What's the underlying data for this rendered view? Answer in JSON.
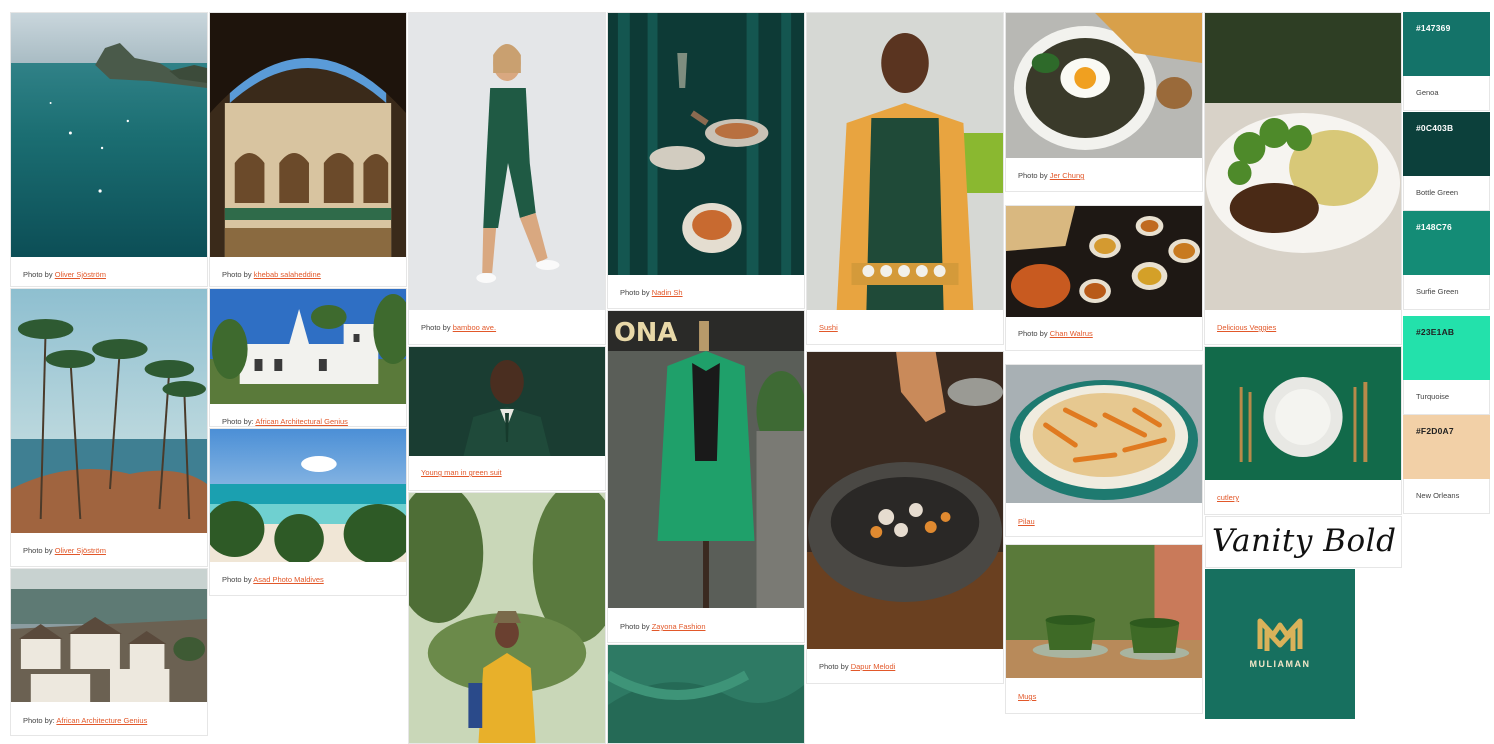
{
  "cards": [
    {
      "id": "c1",
      "caption_prefix": "Photo by",
      "caption_link": "Oliver Sjöström"
    },
    {
      "id": "c2",
      "caption_prefix": "Photo by",
      "caption_link": "Oliver Sjöström"
    },
    {
      "id": "c3",
      "caption_prefix": "Photo by:",
      "caption_link": "African Architecture Genius"
    },
    {
      "id": "c4",
      "caption_prefix": "Photo by",
      "caption_link": "khebab salaheddine"
    },
    {
      "id": "c5",
      "caption_prefix": "Photo by:",
      "caption_link": "African Architectural Genius"
    },
    {
      "id": "c6",
      "caption_prefix": "Photo by",
      "caption_link": "Asad Photo Maldives"
    },
    {
      "id": "c7",
      "caption_prefix": "Photo by",
      "caption_link": "bamboo ave."
    },
    {
      "id": "c8",
      "caption_prefix": "",
      "caption_link": "Young man in green suit"
    },
    {
      "id": "c9",
      "caption_prefix": "Photo by",
      "caption_link": "Nadin Sh"
    },
    {
      "id": "c10",
      "caption_prefix": "Photo by",
      "caption_link": "Zayona Fashion"
    },
    {
      "id": "c11",
      "caption_prefix": "",
      "caption_link": "Sushi"
    },
    {
      "id": "c12",
      "caption_prefix": "Photo by",
      "caption_link": "Dapur Melodi"
    },
    {
      "id": "c13",
      "caption_prefix": "Photo by",
      "caption_link": "Jer Chung"
    },
    {
      "id": "c14",
      "caption_prefix": "Photo by",
      "caption_link": "Chan Walrus"
    },
    {
      "id": "c15",
      "caption_prefix": "",
      "caption_link": "Pilau"
    },
    {
      "id": "c16",
      "caption_prefix": "",
      "caption_link": "Mugs"
    },
    {
      "id": "c17",
      "caption_prefix": "",
      "caption_link": "Delicious Veggies"
    },
    {
      "id": "c18",
      "caption_prefix": "",
      "caption_link": "cutlery"
    }
  ],
  "swatches": [
    {
      "hex": "#147369",
      "name": "Genoa",
      "color": "#147369"
    },
    {
      "hex": "#0C403B",
      "name": "Bottle Green",
      "color": "#0C403B"
    },
    {
      "hex": "#148C76",
      "name": "Surfie Green",
      "color": "#148C76"
    },
    {
      "hex": "#23E1AB",
      "name": "Turquoise",
      "color": "#23E1AB"
    },
    {
      "hex": "#F2D0A7",
      "name": "New Orleans",
      "color": "#F2D0A7"
    }
  ],
  "font_sample": "Vanity Bold",
  "logo": {
    "text": "MULIAMAN",
    "bg": "#17705f",
    "gold": "#d9b25a"
  },
  "link_color": "#e2582a"
}
